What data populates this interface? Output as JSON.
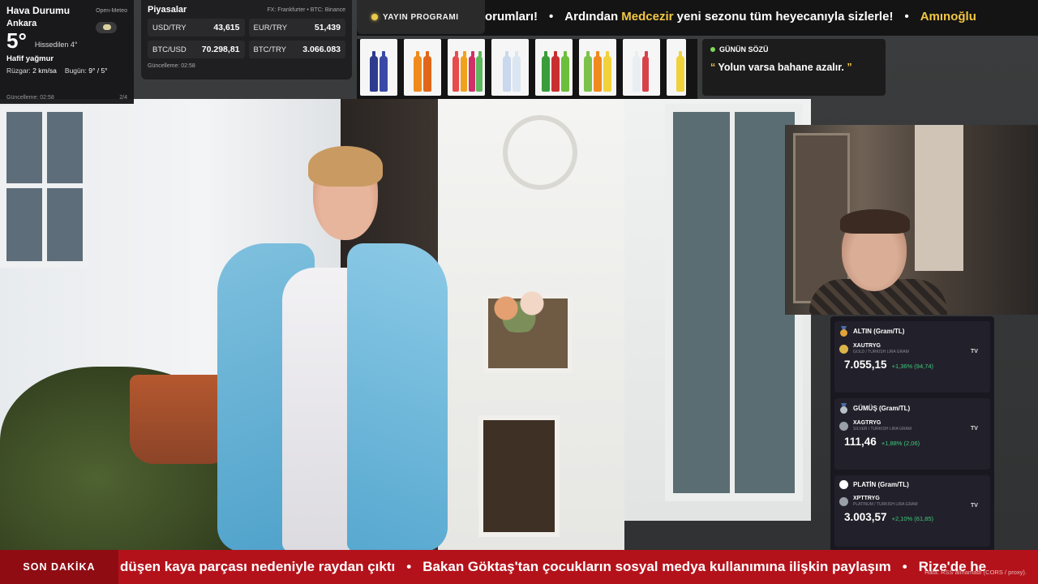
{
  "weather": {
    "title": "Hava Durumu",
    "source": "Open-Meteo",
    "city": "Ankara",
    "temp": "5°",
    "feels": "Hissedilen 4°",
    "condition": "Hafif yağmur",
    "wind_label": "Rüzgar:",
    "wind_value": "2 km/sa",
    "today_label": "Bugün:",
    "today_value": "9° / 5°",
    "updated": "Güncelleme: 02:58",
    "page": "2/4",
    "icon": "rain-cloud-icon"
  },
  "markets": {
    "title": "Piyasalar",
    "source": "FX: Frankfurter • BTC: Binance",
    "items": [
      {
        "pair": "USD/TRY",
        "value": "43,615"
      },
      {
        "pair": "EUR/TRY",
        "value": "51,439"
      },
      {
        "pair": "BTC/USD",
        "value": "70.298,81"
      },
      {
        "pair": "BTC/TRY",
        "value": "3.066.083"
      }
    ],
    "updated": "Güncelleme: 02:58"
  },
  "schedule": {
    "label": "YAYIN PROGRAMI",
    "ticker": {
      "part1": "orumları!",
      "part2": "Ardından",
      "highlight": "Medcezir",
      "part3": "yeni sezonu tüm heyecanıyla sizlerle!",
      "highlight2": "Amınoğlu",
      "sep": "•"
    }
  },
  "quote": {
    "title": "GÜNÜN SÖZÜ",
    "open_mark": "“",
    "text": "Yolun varsa bahane azalır.",
    "close_mark": "”"
  },
  "metals": [
    {
      "title": "ALTIN (Gram/TL)",
      "symbol": "XAUTRYG",
      "sub": "GOLD / TURKISH LIRA GRAM",
      "value": "7.055,15",
      "change": "+1,36% (94,74)",
      "medal_color": "#e0a43a",
      "coin_color": "#d9b54a"
    },
    {
      "title": "GÜMÜŞ (Gram/TL)",
      "symbol": "XAGTRYG",
      "sub": "SILVER / TURKISH LIRA GRAM",
      "value": "111,46",
      "change": "+1,88% (2,06)",
      "medal_color": "#b9c0c8",
      "coin_color": "#9aa0a8"
    },
    {
      "title": "PLATİN (Gram/TL)",
      "symbol": "XPTTRYG",
      "sub": "PLATINUM / TURKISH LIRA GRAM",
      "value": "3.003,57",
      "change": "+2,10% (61,85)",
      "medal_color": "#ffffff",
      "coin_color": "#9aa0a8"
    }
  ],
  "breaking": {
    "label": "SON DAKİKA",
    "items": [
      "düşen kaya parçası nedeniyle raydan çıktı",
      "Bakan Göktaş'tan çocukların sosyal medya kullanımına ilişkin paylaşım",
      "Rize'de he"
    ],
    "sep": "•",
    "rss_error": "Hata: RSS alınamadı (CORS / proxy)."
  },
  "colors": {
    "breaking_red": "#b4121b",
    "accent_yellow": "#f2c744",
    "positive_green": "#3ec97a"
  }
}
